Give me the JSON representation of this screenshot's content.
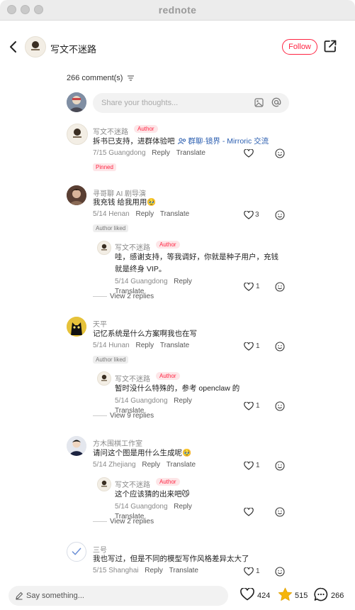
{
  "window": {
    "title": "rednote"
  },
  "header": {
    "author_name": "写文不迷路",
    "follow_label": "Follow"
  },
  "comments_header": {
    "count_label": "266 comment(s)"
  },
  "composer": {
    "placeholder": "Share your thoughts..."
  },
  "comments": [
    {
      "name": "写文不迷路",
      "badge": "Author",
      "text_prefix": "拆书已支持，进群体验吧 ",
      "link_text": "群聊·镜界 - Mirroric 交流",
      "date": "7/15 Guangdong",
      "reply": "Reply",
      "translate": "Translate",
      "tag": "Pinned",
      "likes": ""
    },
    {
      "name": "寻哥聊 AI 剧导演",
      "text": "我充钱 给我用用🥹",
      "date": "5/14 Henan",
      "reply": "Reply",
      "translate": "Translate",
      "tag": "Author liked",
      "likes": "3",
      "reply_item": {
        "name": "写文不迷路",
        "badge": "Author",
        "text1": "哇，感谢支持，等我调好，你就是种子用户，充钱",
        "text2": "就是终身 VIP。",
        "date": "5/14 Guangdong",
        "reply": "Reply",
        "translate": "Translate",
        "likes": "1"
      },
      "view_replies": "View 2 replies"
    },
    {
      "name": "天平",
      "text": "记忆系统是什么方案啊我也在写",
      "date": "5/14 Hunan",
      "reply": "Reply",
      "translate": "Translate",
      "tag": "Author liked",
      "likes": "1",
      "reply_item": {
        "name": "写文不迷路",
        "badge": "Author",
        "text1": "暂时没什么特殊的，参考 openclaw 的",
        "date": "5/14 Guangdong",
        "reply": "Reply",
        "translate": "Translate",
        "likes": "1"
      },
      "view_replies": "View 9 replies"
    },
    {
      "name": "方木围棋工作室",
      "text": "请问这个图是用什么生成呢🥹",
      "date": "5/14 Zhejiang",
      "reply": "Reply",
      "translate": "Translate",
      "likes": "1",
      "reply_item": {
        "name": "写文不迷路",
        "badge": "Author",
        "text1": "这个应该猜的出来吧😼",
        "date": "5/14 Guangdong",
        "reply": "Reply",
        "translate": "Translate",
        "likes": ""
      },
      "view_replies": "View 2 replies"
    },
    {
      "name": "三号",
      "text": "我也写过，但是不同的模型写作风格差异太大了",
      "date": "5/15 Shanghai",
      "reply": "Reply",
      "translate": "Translate",
      "likes": "1"
    }
  ],
  "bottom": {
    "placeholder": "Say something...",
    "likes": "424",
    "collects": "515",
    "comments": "266"
  },
  "colors": {
    "accent": "#ff2442",
    "star": "#f5b50a"
  }
}
